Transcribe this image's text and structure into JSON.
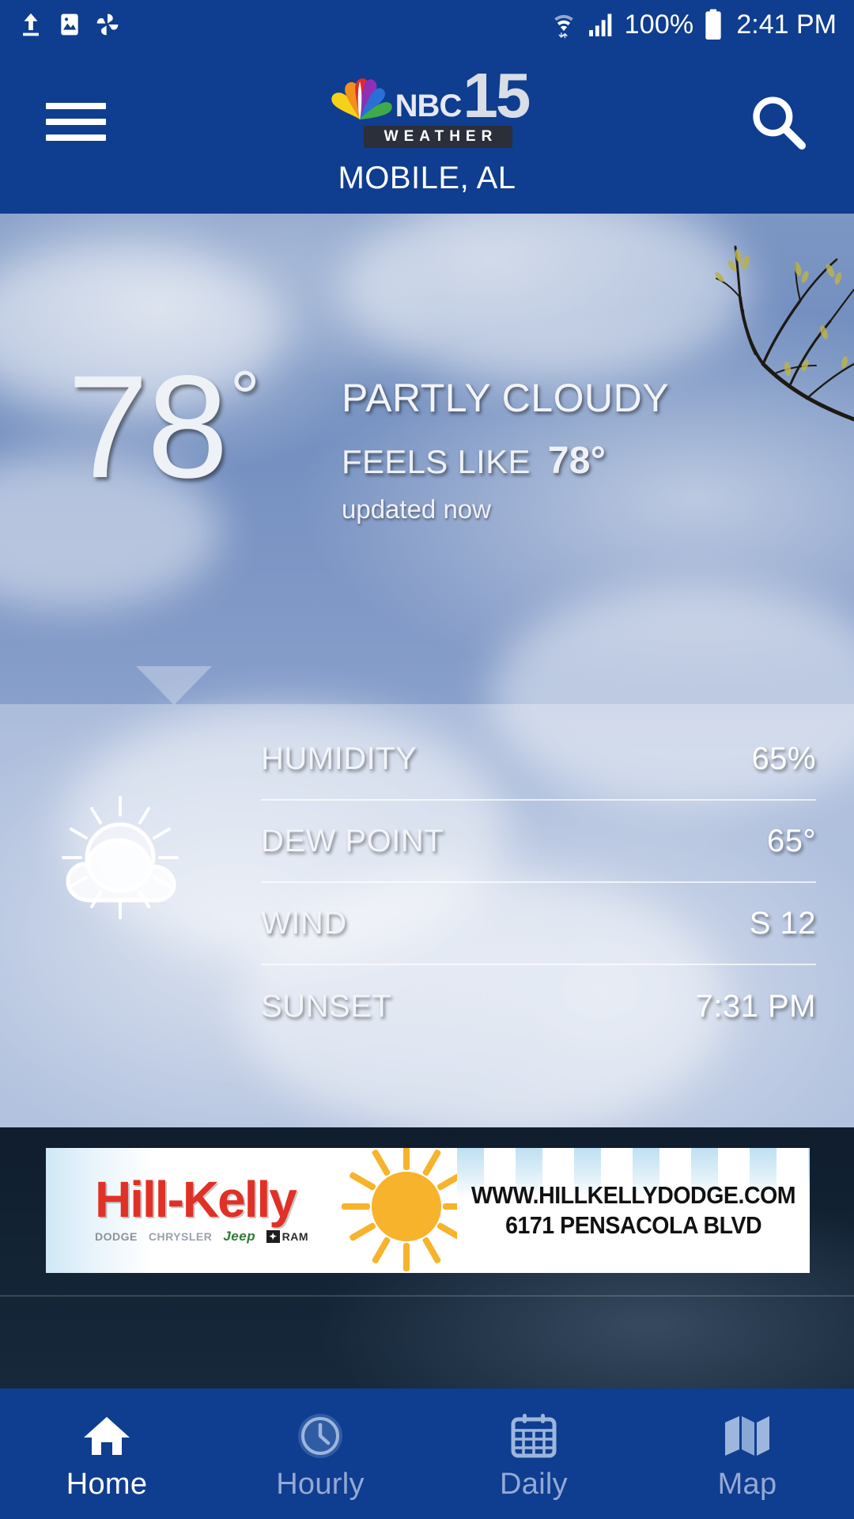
{
  "statusbar": {
    "battery_text": "100%",
    "clock": "2:41 PM",
    "icons": [
      "upload-icon",
      "image-icon",
      "pinwheel-icon",
      "wifi-icon",
      "signal-icon",
      "battery-icon"
    ]
  },
  "header": {
    "menu_icon": "hamburger-menu-icon",
    "search_icon": "search-icon",
    "brand_nbc": "NBC",
    "brand_number": "15",
    "brand_weather": "WEATHER",
    "city": "MOBILE, AL"
  },
  "current": {
    "temperature": "78",
    "degree": "°",
    "condition": "PARTLY CLOUDY",
    "feels_like_label": "FEELS LIKE",
    "feels_like_value": "78°",
    "updated": "updated now",
    "icon": "sun-behind-cloud-icon"
  },
  "details": {
    "rows": [
      {
        "label": "HUMIDITY",
        "value": "65%"
      },
      {
        "label": "DEW POINT",
        "value": "65°"
      },
      {
        "label": "WIND",
        "value": "S 12"
      },
      {
        "label": "SUNSET",
        "value": "7:31 PM"
      }
    ]
  },
  "ad": {
    "brand": "Hill-Kelly",
    "marque_dodge": "DODGE",
    "marque_chrysler": "CHRYSLER",
    "marque_jeep": "Jeep",
    "marque_ram_box": "✦",
    "marque_ram": "RAM",
    "url": "WWW.HILLKELLYDODGE.COM",
    "address": "6171 PENSACOLA BLVD"
  },
  "nav": {
    "items": [
      {
        "label": "Home",
        "icon": "home-icon",
        "active": true
      },
      {
        "label": "Hourly",
        "icon": "clock-icon",
        "active": false
      },
      {
        "label": "Daily",
        "icon": "calendar-icon",
        "active": false
      },
      {
        "label": "Map",
        "icon": "map-icon",
        "active": false
      }
    ]
  },
  "colors": {
    "header_blue": "#0f3d8f",
    "ad_red": "#e03127",
    "nav_active": "#ffffff",
    "nav_inactive": "#93a9d4"
  }
}
